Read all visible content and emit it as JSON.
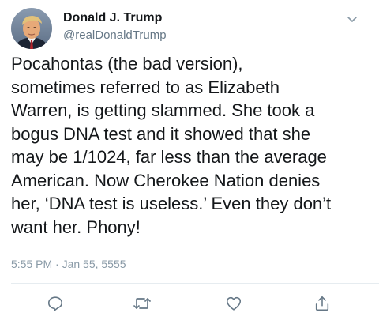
{
  "user": {
    "name": "Donald J. Trump",
    "handle": "@realDonaldTrump"
  },
  "tweet": {
    "text": "Pocahontas (the bad version),\nsometimes referred to as Elizabeth\nWarren, is getting slammed. She took a\nbogus DNA test and it showed that she\nmay be 1/1024, far less than the average\nAmerican. Now Cherokee Nation denies\nher, ‘DNA test is useless.’ Even they don’t\nwant her. Phony!",
    "timestamp": "5:55 PM · Jan 55, 5555"
  },
  "icons": {
    "menu": "chevron-down-icon",
    "reply": "reply-icon",
    "retweet": "retweet-icon",
    "like": "heart-icon",
    "share": "share-icon"
  },
  "colors": {
    "text": "#14171a",
    "secondary": "#657786",
    "icon": "#657786",
    "divider": "#e6ecf0"
  }
}
